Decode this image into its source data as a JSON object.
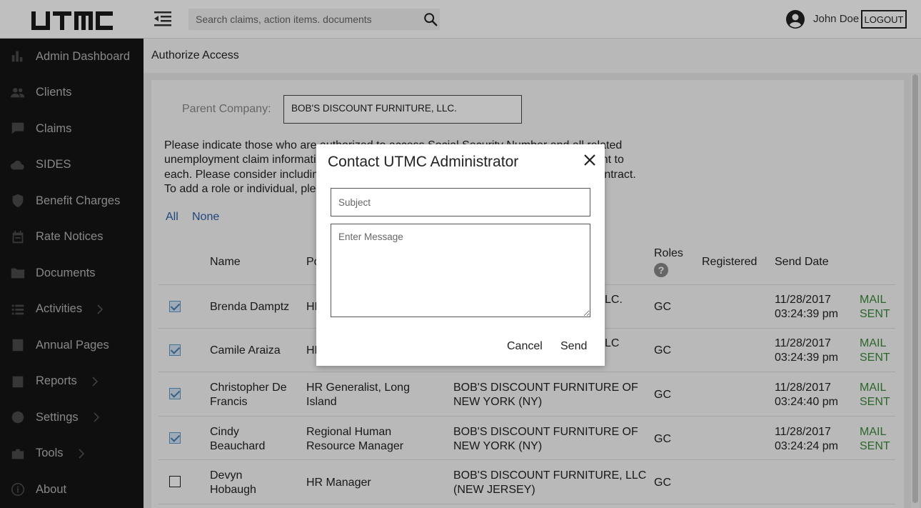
{
  "app": {
    "logo_text": "UTMC"
  },
  "topbar": {
    "search_placeholder": "Search claims, action items. documents",
    "user_name": "John Doe",
    "logout_label": "LOGOUT"
  },
  "sidebar": {
    "items": [
      {
        "label": "Admin Dashboard",
        "icon": "bar-chart-icon",
        "has_submenu": false
      },
      {
        "label": "Clients",
        "icon": "people-icon",
        "has_submenu": false
      },
      {
        "label": "Claims",
        "icon": "comment-icon",
        "has_submenu": false
      },
      {
        "label": "SIDES",
        "icon": "cloud-icon",
        "has_submenu": false
      },
      {
        "label": "Benefit Charges",
        "icon": "verified-shield-icon",
        "has_submenu": false
      },
      {
        "label": "Rate Notices",
        "icon": "calendar-icon",
        "has_submenu": false
      },
      {
        "label": "Documents",
        "icon": "folder-icon",
        "has_submenu": false
      },
      {
        "label": "Activities",
        "icon": "list-icon",
        "has_submenu": true
      },
      {
        "label": "Annual Pages",
        "icon": "document-icon",
        "has_submenu": false
      },
      {
        "label": "Reports",
        "icon": "assignment-check-icon",
        "has_submenu": true
      },
      {
        "label": "Settings",
        "icon": "gear-icon",
        "has_submenu": true
      },
      {
        "label": "Tools",
        "icon": "toolbox-icon",
        "has_submenu": true
      },
      {
        "label": "About",
        "icon": "info-icon",
        "has_submenu": false
      }
    ]
  },
  "page": {
    "title": "Authorize Access",
    "parent_company_label": "Parent Company:",
    "parent_company_value": "BOB'S DISCOUNT FURNITURE, LLC.",
    "instructions_lines": [
      "Please indicate those who are authorized to access Social Security Number and all related",
      "unemployment claim information. Authorized individuals will be sent an e-mail to consent to",
      "each. Please consider including individuals whose roles are covered by your service contract.",
      "To add a role or individual, please contact your UTMC Administrator."
    ],
    "select_all_label": "All",
    "select_none_label": "None"
  },
  "table": {
    "headers": {
      "name": "Name",
      "position": "Position",
      "roles": "Roles",
      "registered": "Registered",
      "send_date": "Send Date"
    },
    "rows": [
      {
        "checked": true,
        "name": "Brenda Damptz",
        "position": "HR",
        "company": "BOB'S DISCOUNT FURNITURE, LLC.",
        "role": "GC",
        "registered": "",
        "send_date": "11/28/2017",
        "send_time": "03:24:39 pm",
        "status1": "MAIL",
        "status2": "SENT"
      },
      {
        "checked": true,
        "name": "Camile Araiza",
        "position": "HR",
        "company": "BOB'S DISCOUNT FURNITURE, LLC",
        "role": "GC",
        "registered": "",
        "send_date": "11/28/2017",
        "send_time": "03:24:39 pm",
        "status1": "MAIL",
        "status2": "SENT"
      },
      {
        "checked": true,
        "name1": "Christopher De",
        "name2": "Francis",
        "position1": "HR Generalist, Long",
        "position2": "Island",
        "company1": "BOB'S DISCOUNT FURNITURE OF",
        "company2": "NEW YORK (NY)",
        "role": "GC",
        "send_date": "11/28/2017",
        "send_time": "03:24:40 pm",
        "status1": "MAIL",
        "status2": "SENT"
      },
      {
        "checked": true,
        "name1": "Cindy",
        "name2": "Beauchard",
        "position1": "Regional Human",
        "position2": "Resource Manager",
        "company1": "BOB'S DISCOUNT FURNITURE OF",
        "company2": "NEW YORK (NY)",
        "role": "GC",
        "send_date": "11/28/2017",
        "send_time": "03:24:24 pm",
        "status1": "MAIL",
        "status2": "SENT"
      },
      {
        "checked": false,
        "name1": "Devyn",
        "name2": "Hobaugh",
        "position1": "HR Manager",
        "company1": "BOB'S DISCOUNT FURNITURE, LLC",
        "company2": "(NEW JERSEY)",
        "role": "GC",
        "send_date": "",
        "send_time": "",
        "status1": "",
        "status2": ""
      }
    ],
    "partial_company_rows": [
      "LC.",
      "LC"
    ]
  },
  "modal": {
    "title": "Contact UTMC Administrator",
    "subject_placeholder": "Subject",
    "message_placeholder": "Enter Message",
    "cancel_label": "Cancel",
    "send_label": "Send"
  },
  "colors": {
    "sidebar_bg": "#141414",
    "link": "#2b5ea8",
    "status_green": "#3a8a3a"
  }
}
